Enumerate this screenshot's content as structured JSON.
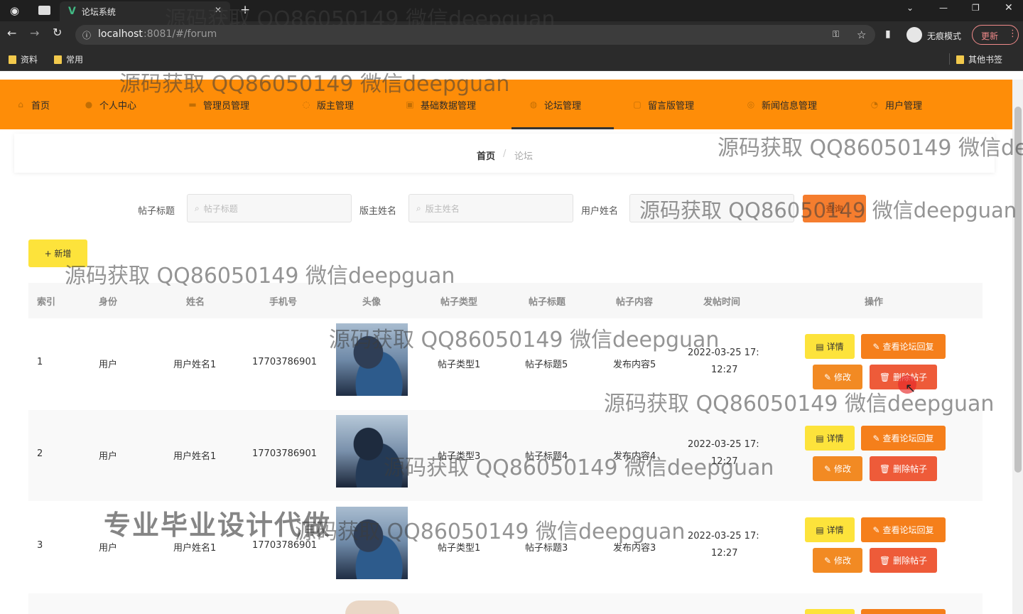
{
  "browser": {
    "tab_title": "论坛系统",
    "url_host": "localhost",
    "url_rest": ":8081/#/forum",
    "incognito_label": "无痕模式",
    "update_label": "更新",
    "bookmarks": [
      "资料",
      "常用"
    ],
    "other_bookmarks": "其他书签"
  },
  "nav": {
    "items": [
      "首页",
      "个人中心",
      "管理员管理",
      "版主管理",
      "基础数据管理",
      "论坛管理",
      "留言版管理",
      "新闻信息管理",
      "用户管理"
    ],
    "active_index": 5
  },
  "breadcrumb": {
    "home": "首页",
    "separator": "/",
    "current": "论坛"
  },
  "search": {
    "title_label": "帖子标题",
    "title_placeholder": "帖子标题",
    "moderator_label": "版主姓名",
    "moderator_placeholder": "版主姓名",
    "user_label": "用户姓名",
    "button_label": "查询"
  },
  "toolbar": {
    "add_label": "+ 新增"
  },
  "table": {
    "headers": [
      "索引",
      "身份",
      "姓名",
      "手机号",
      "头像",
      "帖子类型",
      "帖子标题",
      "帖子内容",
      "发帖时间",
      "操作"
    ],
    "rows": [
      {
        "index": "1",
        "role": "用户",
        "name": "用户姓名1",
        "phone": "17703786901",
        "type": "帖子类型1",
        "title": "帖子标题5",
        "content": "发布内容5",
        "time_line1": "2022-03-25 17:",
        "time_line2": "12:27"
      },
      {
        "index": "2",
        "role": "用户",
        "name": "用户姓名1",
        "phone": "17703786901",
        "type": "帖子类型3",
        "title": "帖子标题4",
        "content": "发布内容4",
        "time_line1": "2022-03-25 17:",
        "time_line2": "12:27"
      },
      {
        "index": "3",
        "role": "用户",
        "name": "用户姓名1",
        "phone": "17703786901",
        "type": "帖子类型1",
        "title": "帖子标题3",
        "content": "发布内容3",
        "time_line1": "2022-03-25 17:",
        "time_line2": "12:27"
      }
    ],
    "actions": {
      "detail": "详情",
      "view_replies": "查看论坛回复",
      "edit": "修改",
      "delete": "删除帖子"
    }
  },
  "watermarks": {
    "contact": "源码获取 QQ86050149 微信deepguan",
    "contact_clipped": "源码获取 QQ86050149 微信de",
    "slogan": "专业毕业设计代做"
  }
}
